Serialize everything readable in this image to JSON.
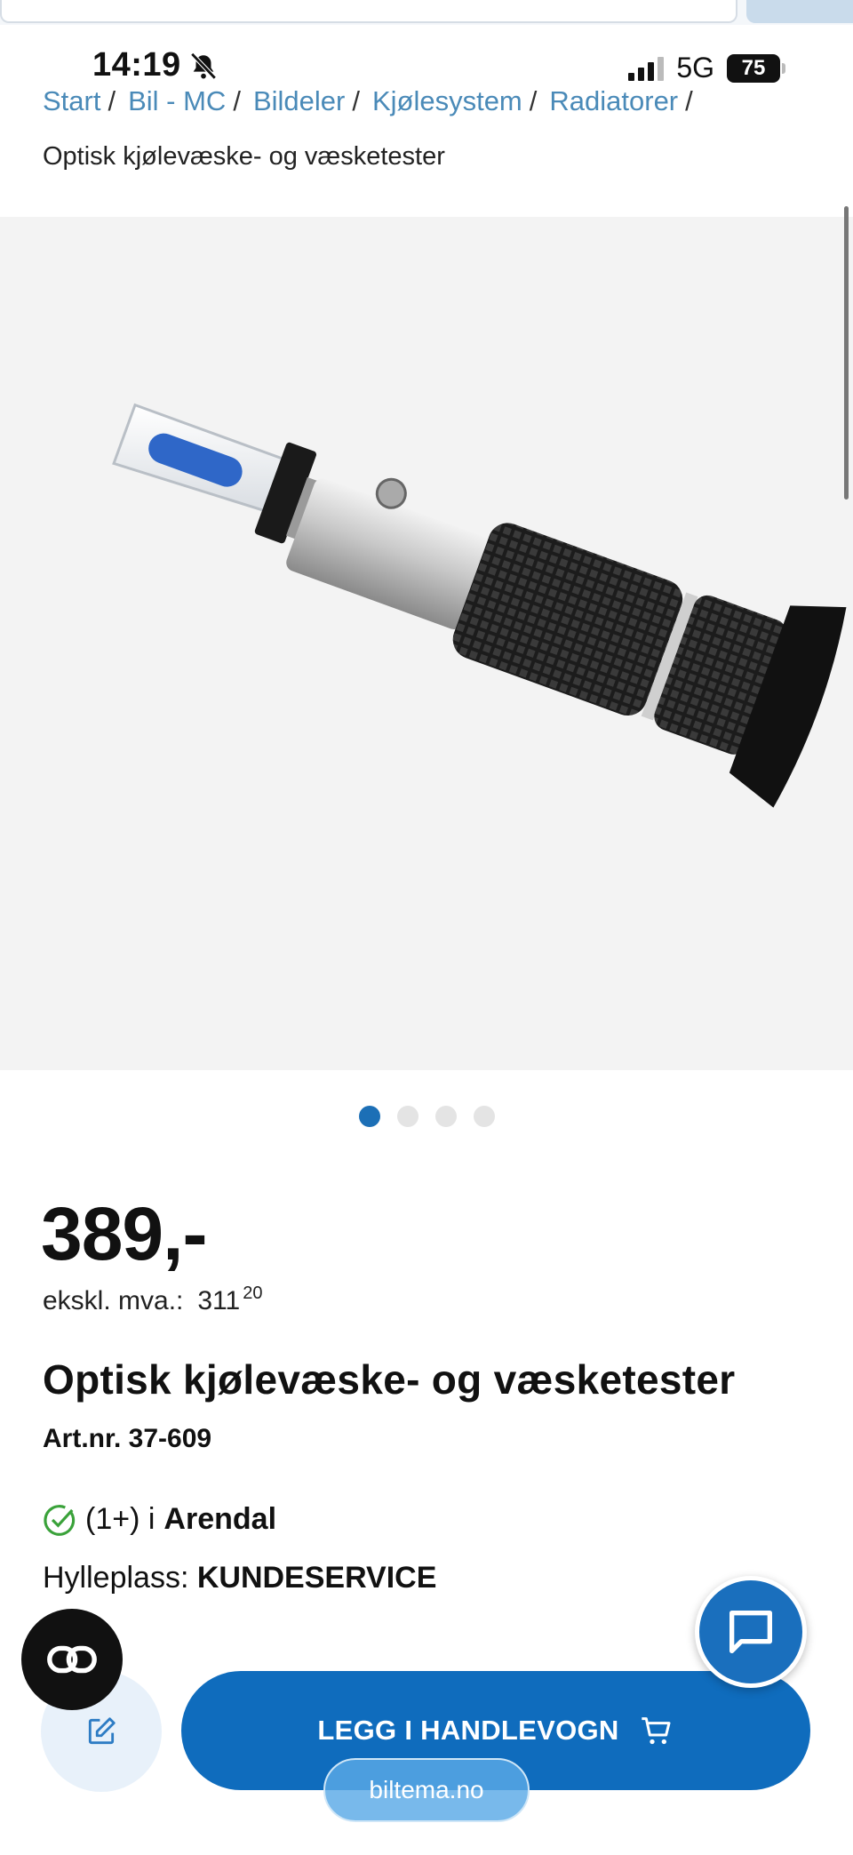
{
  "status_bar": {
    "time": "14:19",
    "network": "5G",
    "battery": "75"
  },
  "breadcrumb": {
    "items": [
      "Start",
      "Bil - MC",
      "Bildeler",
      "Kjølesystem",
      "Radiatorer"
    ],
    "separator": "/",
    "current": "Optisk kjølevæske- og væsketester"
  },
  "gallery": {
    "image_subject": "refractometer",
    "dot_count": 4,
    "active_index": 0
  },
  "product": {
    "price": "389,-",
    "ex_vat_label": "ekskl. mva.:",
    "ex_vat_amount": "311",
    "ex_vat_decimals": "20",
    "title": "Optisk kjølevæske- og væsketester",
    "art_nr": "Art.nr. 37-609"
  },
  "availability": {
    "count": "(1+) i",
    "store": "Arendal",
    "shelf_label": "Hylleplass:",
    "shelf_value": "KUNDESERVICE"
  },
  "actions": {
    "add_to_cart": "LEGG I HANDLEVOGN",
    "url": "biltema.no"
  },
  "colors": {
    "accent": "#0f6cbd",
    "link": "#4a8ab8",
    "stock_ok": "#3aa23a"
  }
}
